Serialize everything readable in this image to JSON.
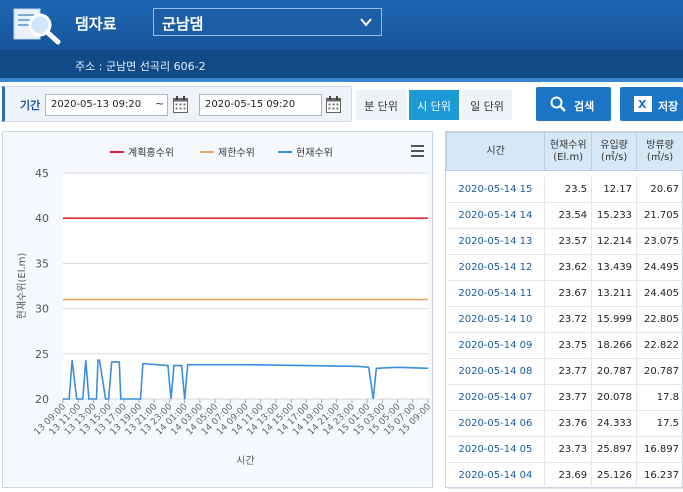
{
  "header": {
    "app_title": "댐자료",
    "dam_name": "군남댐",
    "address": "주소 : 군남면 선곡리 606-2"
  },
  "filter": {
    "period_label": "기간",
    "start_date": "2020-05-13 09:20",
    "separator": "~",
    "end_date": "2020-05-15 09:20",
    "units": [
      "분 단위",
      "시 단위",
      "일 단위"
    ],
    "active_unit": "시 단위",
    "search_label": "검색",
    "save_label": "저장"
  },
  "colors": {
    "plan_flood": "#e0242b",
    "limit": "#f0a35e",
    "current": "#3a8ee0",
    "accent": "#1b74c6"
  },
  "table": {
    "headers": {
      "time": "시간",
      "level": "현재수위",
      "level_unit": "(El.m)",
      "inflow": "유입량",
      "inflow_unit": "(㎥/s)",
      "outflow": "방류량",
      "outflow_unit": "(㎥/s)"
    },
    "rows": [
      {
        "time": "2020-05-14 15",
        "level": "23.5",
        "inflow": "12.17",
        "outflow": "20.67"
      },
      {
        "time": "2020-05-14 14",
        "level": "23.54",
        "inflow": "15.233",
        "outflow": "21.705"
      },
      {
        "time": "2020-05-14 13",
        "level": "23.57",
        "inflow": "12.214",
        "outflow": "23.075"
      },
      {
        "time": "2020-05-14 12",
        "level": "23.62",
        "inflow": "13.439",
        "outflow": "24.495"
      },
      {
        "time": "2020-05-14 11",
        "level": "23.67",
        "inflow": "13.211",
        "outflow": "24.405"
      },
      {
        "time": "2020-05-14 10",
        "level": "23.72",
        "inflow": "15.999",
        "outflow": "22.805"
      },
      {
        "time": "2020-05-14 09",
        "level": "23.75",
        "inflow": "18.266",
        "outflow": "22.822"
      },
      {
        "time": "2020-05-14 08",
        "level": "23.77",
        "inflow": "20.787",
        "outflow": "20.787"
      },
      {
        "time": "2020-05-14 07",
        "level": "23.77",
        "inflow": "20.078",
        "outflow": "17.8"
      },
      {
        "time": "2020-05-14 06",
        "level": "23.76",
        "inflow": "24.333",
        "outflow": "17.5"
      },
      {
        "time": "2020-05-14 05",
        "level": "23.73",
        "inflow": "25.897",
        "outflow": "16.897"
      },
      {
        "time": "2020-05-14 04",
        "level": "23.69",
        "inflow": "25.126",
        "outflow": "16.237"
      }
    ]
  },
  "chart_data": {
    "type": "line",
    "ylabel": "현재수위(El.m)",
    "xlabel": "시간",
    "ylim": [
      20,
      45
    ],
    "yticks": [
      20,
      25,
      30,
      35,
      40,
      45
    ],
    "xticks": [
      "13 09:00",
      "13 11:00",
      "13 13:00",
      "13 15:00",
      "13 17:00",
      "13 19:00",
      "13 21:00",
      "13 23:00",
      "14 01:00",
      "14 03:00",
      "14 05:00",
      "14 07:00",
      "14 09:00",
      "14 11:00",
      "14 13:00",
      "14 15:00",
      "14 17:00",
      "14 19:00",
      "14 21:00",
      "14 23:00",
      "15 01:00",
      "15 03:00",
      "15 05:00",
      "15 07:00",
      "15 09:00"
    ],
    "legend_position": "top",
    "grid": true,
    "series": [
      {
        "name": "계획홍수위",
        "color": "#e0242b",
        "x": [
          0,
          48
        ],
        "values": [
          40,
          40
        ]
      },
      {
        "name": "제한수위",
        "color": "#f0a35e",
        "x": [
          0,
          48
        ],
        "values": [
          31,
          31
        ]
      },
      {
        "name": "현재수위",
        "color": "#3a8ee0",
        "x": [
          0,
          0.8,
          1.2,
          1.8,
          2.6,
          3.0,
          3.4,
          4.4,
          4.6,
          4.8,
          5.6,
          6.0,
          6.4,
          7.4,
          7.6,
          7.8,
          10.2,
          10.5,
          10.7,
          13.8,
          14.2,
          14.6,
          15.6,
          16.0,
          16.4,
          24.0,
          32.0,
          39.0,
          40.2,
          40.8,
          41.2,
          44.0,
          48.0
        ],
        "values": [
          20,
          20,
          24.3,
          20,
          20,
          24.3,
          20,
          20,
          24.3,
          24.3,
          20,
          20,
          24.1,
          24.1,
          20,
          20,
          20,
          23.9,
          23.9,
          23.7,
          20,
          23.7,
          23.7,
          20,
          23.8,
          23.8,
          23.7,
          23.6,
          23.5,
          20,
          23.4,
          23.5,
          23.4
        ]
      }
    ]
  }
}
